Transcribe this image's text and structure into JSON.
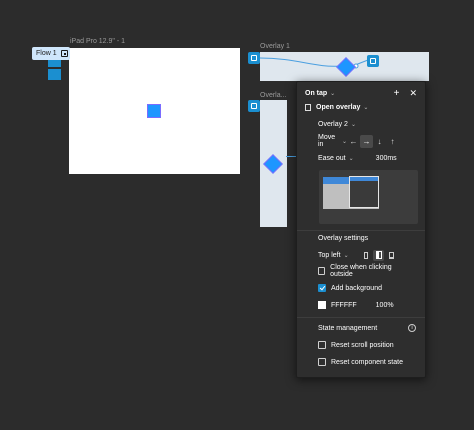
{
  "canvas": {
    "flow_label": "Flow 1",
    "frame_main_label": "iPad Pro 12.9\" - 1",
    "frame_overlay1_label": "Overlay 1",
    "frame_overlay2_label": "Overla..."
  },
  "panel": {
    "trigger": "On tap",
    "action": "Open overlay",
    "destination": "Overlay 2",
    "transition": "Move in",
    "easing": "Ease out",
    "duration": "300ms",
    "directions": [
      "←",
      "→",
      "↓",
      "↑"
    ],
    "active_direction": "→",
    "overlay_settings_title": "Overlay settings",
    "position": "Top left",
    "close_outside_label": "Close when clicking outside",
    "close_outside_checked": false,
    "add_background_label": "Add background",
    "add_background_checked": true,
    "bg_color_hex": "FFFFFF",
    "bg_opacity": "100%",
    "state_title": "State management",
    "reset_scroll_label": "Reset scroll position",
    "reset_scroll_checked": false,
    "reset_component_label": "Reset component state",
    "reset_component_checked": false
  },
  "colors": {
    "canvas_bg": "#2c2c2c",
    "accent": "#1b8fd0",
    "panel_bg": "#2e2e2e"
  }
}
